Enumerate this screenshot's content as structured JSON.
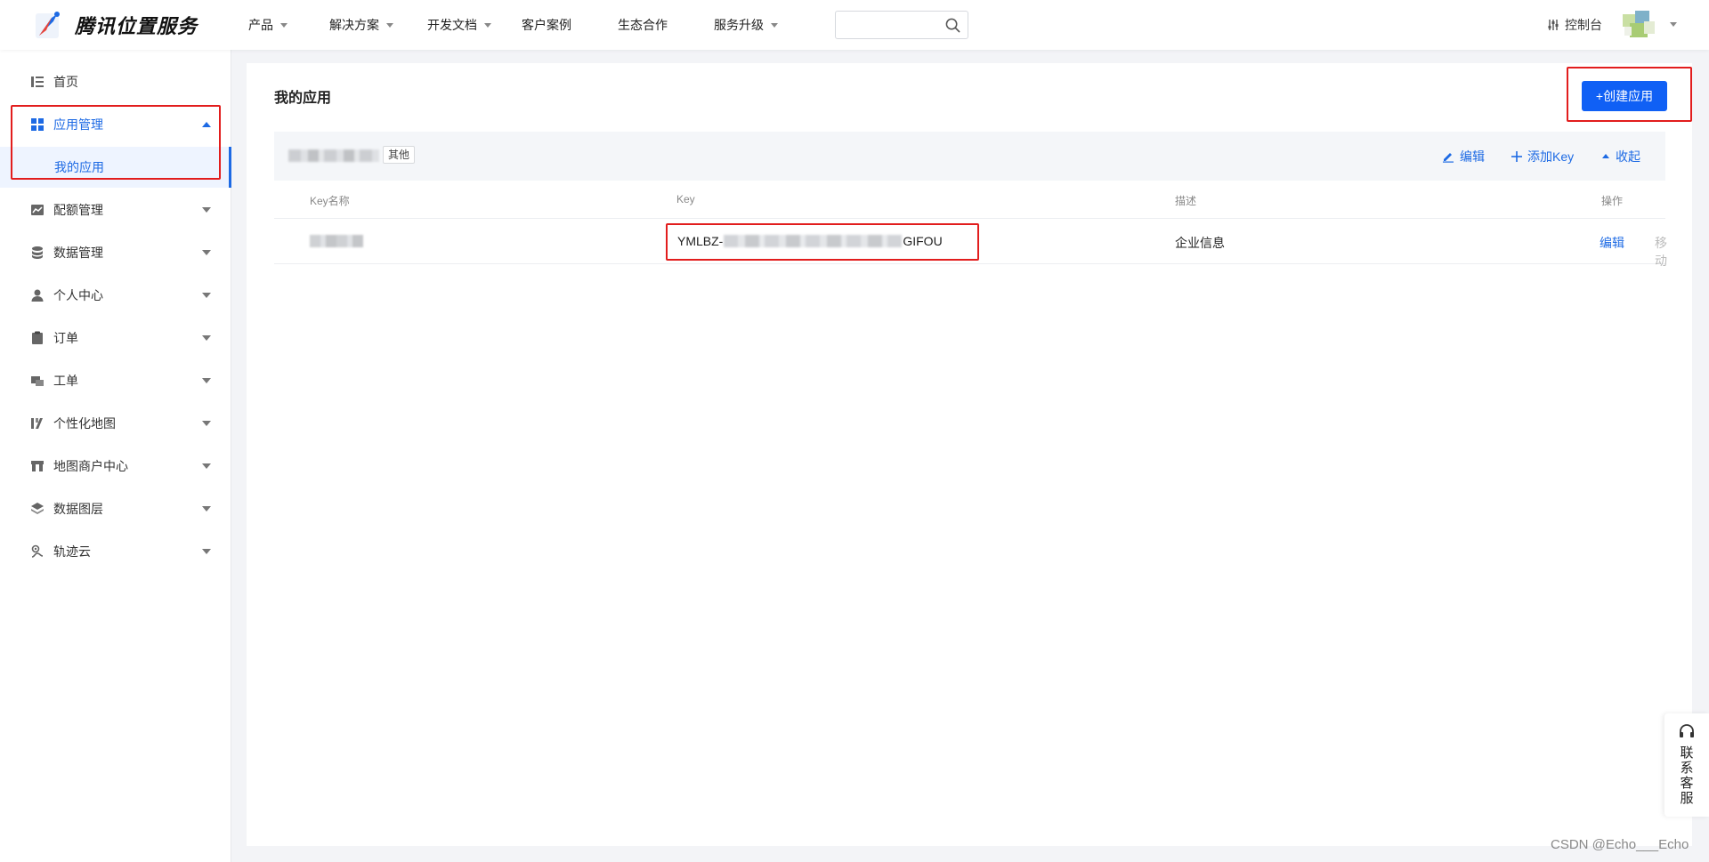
{
  "brand": {
    "name": "腾讯位置服务"
  },
  "nav": {
    "items": [
      {
        "label": "产品",
        "has_caret": true
      },
      {
        "label": "解决方案",
        "has_caret": true
      },
      {
        "label": "开发文档",
        "has_caret": true
      },
      {
        "label": "客户案例",
        "has_caret": false
      },
      {
        "label": "生态合作",
        "has_caret": false
      },
      {
        "label": "服务升级",
        "has_caret": true
      }
    ],
    "search_placeholder": "",
    "console_label": "控制台"
  },
  "sidebar": {
    "items": [
      {
        "label": "首页",
        "icon": "list-icon"
      },
      {
        "label": "应用管理",
        "icon": "grid-icon",
        "expanded": true,
        "active": true
      },
      {
        "label": "配额管理",
        "icon": "chart-icon"
      },
      {
        "label": "数据管理",
        "icon": "database-icon"
      },
      {
        "label": "个人中心",
        "icon": "user-icon"
      },
      {
        "label": "订单",
        "icon": "clipboard-icon"
      },
      {
        "label": "工单",
        "icon": "ticket-icon"
      },
      {
        "label": "个性化地图",
        "icon": "map-style-icon"
      },
      {
        "label": "地图商户中心",
        "icon": "store-icon"
      },
      {
        "label": "数据图层",
        "icon": "layers-icon"
      },
      {
        "label": "轨迹云",
        "icon": "track-icon"
      }
    ],
    "sub_item": "我的应用"
  },
  "main": {
    "title": "我的应用",
    "create_button": "+创建应用",
    "app": {
      "tag": "其他",
      "actions": {
        "edit": "编辑",
        "add_key": "添加Key",
        "collapse": "收起"
      }
    },
    "table": {
      "headers": [
        "Key名称",
        "Key",
        "描述",
        "操作"
      ],
      "rows": [
        {
          "key_prefix": "YMLBZ-",
          "key_suffix": "GIFOU",
          "description": "企业信息",
          "op_edit": "编辑",
          "op_move": "移动"
        }
      ]
    }
  },
  "float_service": {
    "label": "联系客服"
  },
  "watermark": "CSDN @Echo___Echo",
  "colors": {
    "accent": "#1d6ae4",
    "primary_button": "#1060f5",
    "highlight": "#e21d1d"
  }
}
